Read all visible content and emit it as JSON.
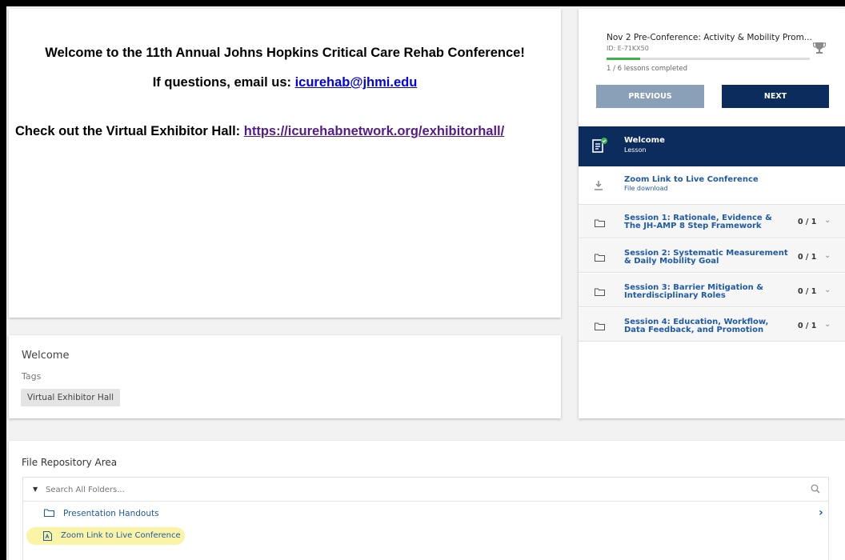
{
  "content": {
    "welcome_line": "Welcome to the 11th Annual Johns Hopkins Critical Care Rehab Conference!",
    "questions_prefix": "If questions, email us: ",
    "email": "icurehab@jhmi.edu",
    "exhibitor_prefix": "Check out the Virtual Exhibitor Hall: ",
    "exhibitor_url": "https://icurehabnetwork.org/exhibitorhall/"
  },
  "info": {
    "title": "Welcome",
    "tags_label": "Tags",
    "tags": [
      "Virtual Exhibitor Hall"
    ]
  },
  "course": {
    "title": "Nov 2 Pre-Conference: Activity & Mobility Prom...",
    "id": "ID: E-71KX50",
    "progress_fraction": 0.1667,
    "progress_text": "1 / 6 lessons completed",
    "prev_label": "PREVIOUS",
    "next_label": "NEXT",
    "progress_color": "#3cb34a",
    "accent": "#0b2c5c"
  },
  "lessons": {
    "active": {
      "title": "Welcome",
      "subtitle": "Lesson"
    },
    "download": {
      "title": "Zoom Link to Live Conference",
      "subtitle": "File download"
    },
    "sessions": [
      {
        "line1": "Session 1: Rationale, Evidence &",
        "line2": "The JH-AMP 8 Step Framework",
        "count": "0 / 1"
      },
      {
        "line1": "Session 2: Systematic Measurement",
        "line2": "& Daily Mobility Goal",
        "count": "0 / 1"
      },
      {
        "line1": "Session 3: Barrier Mitigation &",
        "line2": "Interdisciplinary Roles",
        "count": "0 / 1"
      },
      {
        "line1": "Session 4: Education, Workflow,",
        "line2": "Data Feedback, and Promotion",
        "count": "0 / 1"
      }
    ]
  },
  "repo": {
    "title": "File Repository Area",
    "search_placeholder": "Search All Folders...",
    "folder_label": "Presentation Handouts",
    "file_label": "Zoom Link to Live Conference",
    "highlight_color": "#fbf4a6"
  }
}
